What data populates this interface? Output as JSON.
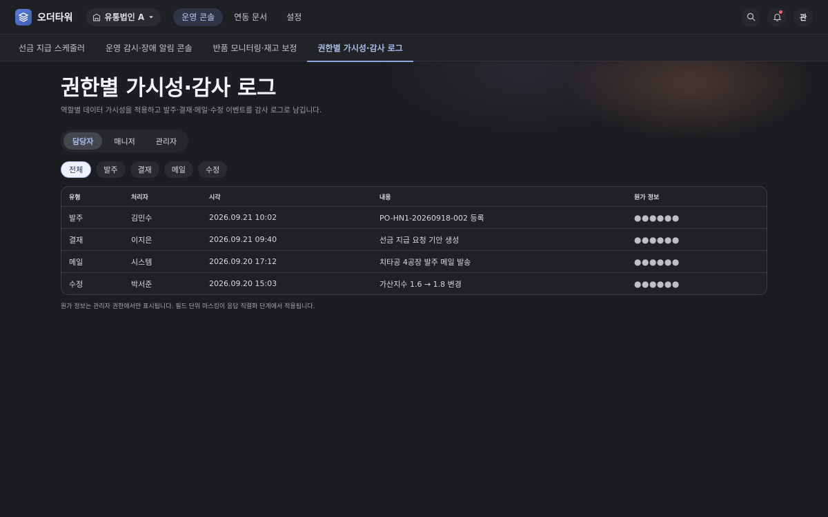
{
  "app": {
    "brand": "오더타워",
    "org": "유통법인 A",
    "avatar": "관"
  },
  "nav": [
    {
      "label": "운영 콘솔",
      "active": true
    },
    {
      "label": "연동 문서",
      "active": false
    },
    {
      "label": "설정",
      "active": false
    }
  ],
  "subnav": [
    {
      "label": "선금 지급 스케줄러",
      "active": false
    },
    {
      "label": "운영 감시·장애 알림 콘솔",
      "active": false
    },
    {
      "label": "반품 모니터링·재고 보정",
      "active": false
    },
    {
      "label": "권한별 가시성·감사 로그",
      "active": true
    }
  ],
  "page": {
    "title": "권한별 가시성·감사 로그",
    "subtitle": "역할별 데이터 가시성을 적용하고 발주·결재·메일·수정 이벤트를 감사 로그로 남깁니다."
  },
  "roles": [
    {
      "label": "담당자",
      "active": true
    },
    {
      "label": "매니저",
      "active": false
    },
    {
      "label": "관리자",
      "active": false
    }
  ],
  "filters": [
    {
      "label": "전체",
      "active": true
    },
    {
      "label": "발주",
      "active": false
    },
    {
      "label": "결재",
      "active": false
    },
    {
      "label": "메일",
      "active": false
    },
    {
      "label": "수정",
      "active": false
    }
  ],
  "table": {
    "headers": [
      "유형",
      "처리자",
      "시각",
      "내용",
      "원가 정보"
    ],
    "rows": [
      [
        "발주",
        "김민수",
        "2026.09.21 10:02",
        "PO-HN1-20260918-002 등록",
        "●●●●●●"
      ],
      [
        "결재",
        "이지은",
        "2026.09.21 09:40",
        "선금 지급 요청 기안 생성",
        "●●●●●●"
      ],
      [
        "메일",
        "시스템",
        "2026.09.20 17:12",
        "치타공 4공장 발주 메일 발송",
        "●●●●●●"
      ],
      [
        "수정",
        "박서준",
        "2026.09.20 15:03",
        "가산지수 1.6 → 1.8 변경",
        "●●●●●●"
      ]
    ]
  },
  "note": "원가 정보는 관리자 권한에서만 표시됩니다. 필드 단위 마스킹이 응답 직렬화 단계에서 적용됩니다."
}
